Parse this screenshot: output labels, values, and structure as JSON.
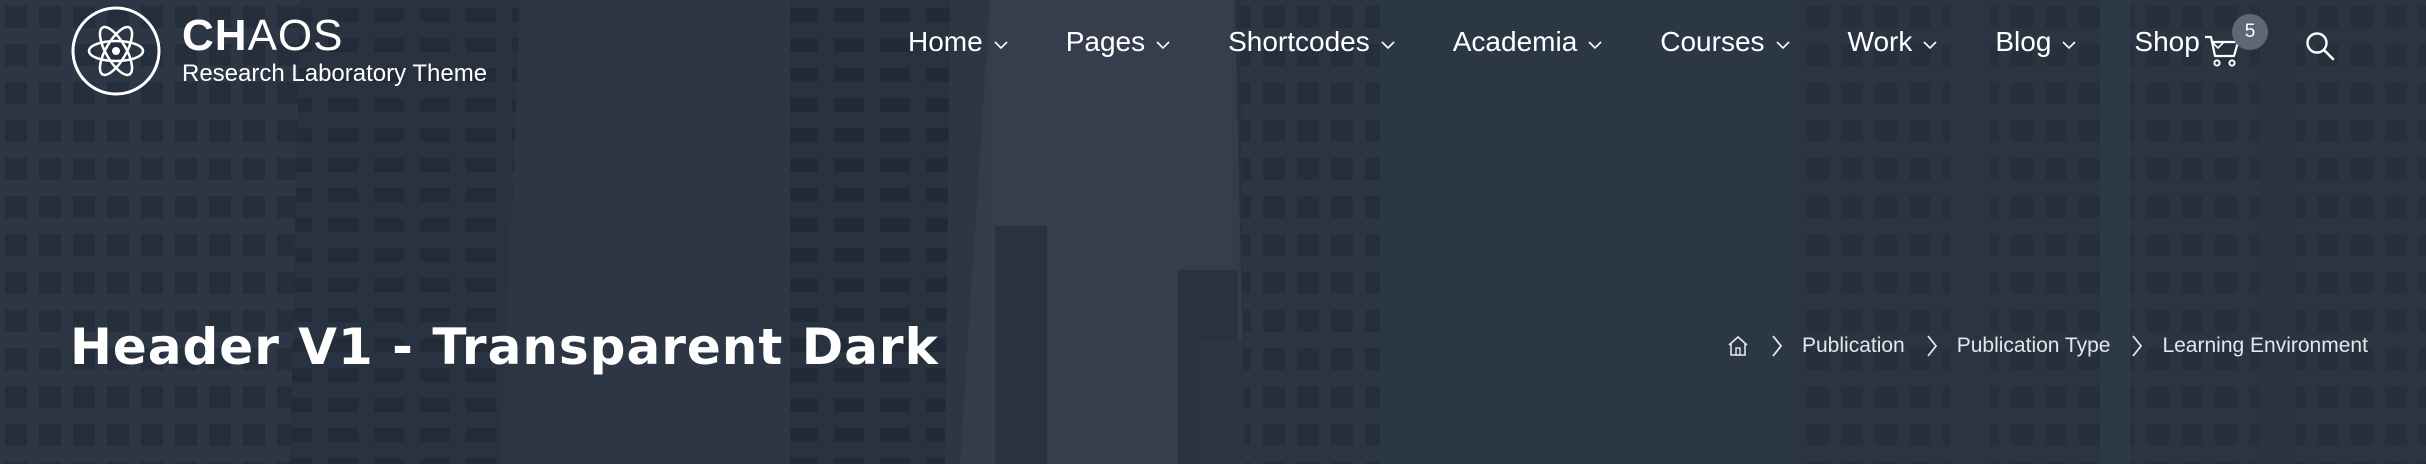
{
  "brand": {
    "name_bold": "CH",
    "name_light": "AOS",
    "tagline": "Research Laboratory Theme"
  },
  "nav": {
    "items": [
      {
        "label": "Home"
      },
      {
        "label": "Pages"
      },
      {
        "label": "Shortcodes"
      },
      {
        "label": "Academia"
      },
      {
        "label": "Courses"
      },
      {
        "label": "Work"
      },
      {
        "label": "Blog"
      },
      {
        "label": "Shop"
      }
    ]
  },
  "cart": {
    "count": "5"
  },
  "page": {
    "title": "Header V1 - Transparent Dark"
  },
  "breadcrumb": {
    "items": [
      {
        "label": "Publication"
      },
      {
        "label": "Publication Type"
      },
      {
        "label": "Learning Environment"
      }
    ]
  },
  "colors": {
    "overlay": "#2c3746",
    "text": "#ffffff",
    "badge": "#5d6875"
  }
}
